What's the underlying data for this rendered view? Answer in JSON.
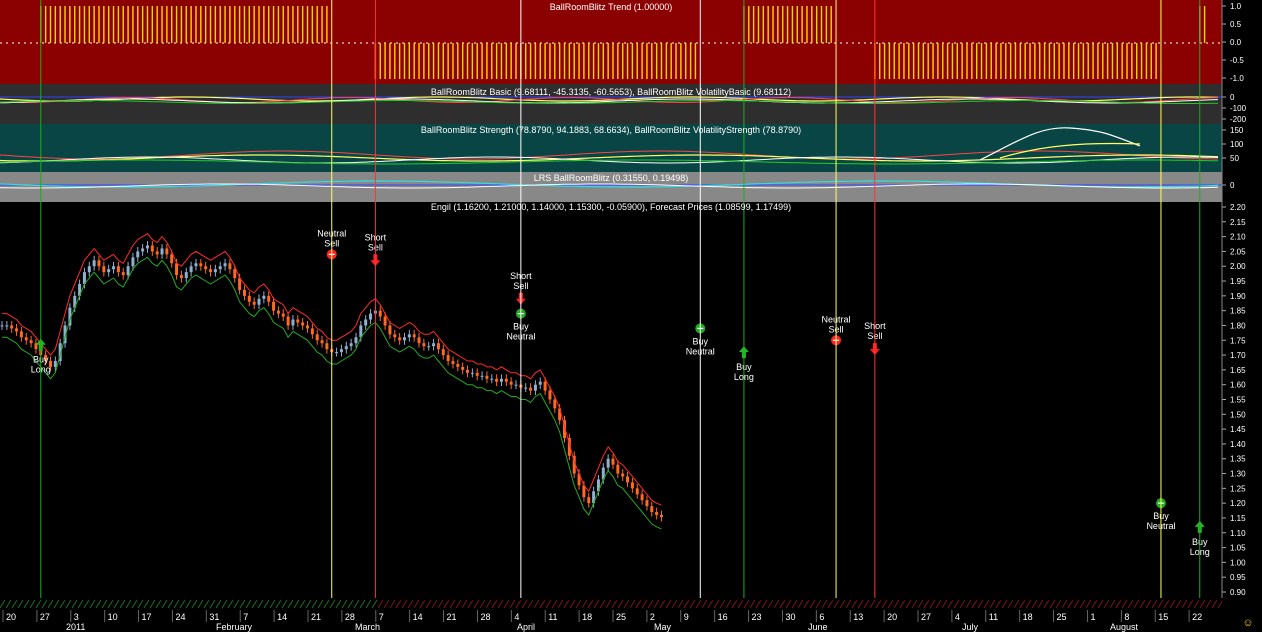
{
  "panels": {
    "trend": {
      "title": "BallRoomBlitz Trend (1.00000)",
      "axis_labels": [
        "1.0",
        "0.5",
        "0.0",
        "-0.5",
        "-1.0"
      ],
      "colors": {
        "bg": "#8b0000",
        "bars": "#ffd700"
      }
    },
    "basic": {
      "title": "BallRoomBlitz Basic (9.68111, -45.3135, -60.5653), BallRoomBlitz VolatilityBasic (9.68112)",
      "axis_labels": [
        "0",
        "-100",
        "-200"
      ],
      "colors": {
        "bg": "#2e2e2e"
      }
    },
    "strength": {
      "title": "BallRoomBlitz Strength (78.8790, 94.1883, 68.6634), BallRoomBlitz VolatilityStrength (78.8790)",
      "axis_labels": [
        "150",
        "100",
        "50"
      ],
      "colors": {
        "bg": "#0a4545"
      }
    },
    "lrs": {
      "title": "LRS BallRoomBlitz (0.31550, 0.19498)",
      "axis_labels": [
        "0"
      ],
      "colors": {
        "bg": "#888888"
      }
    },
    "price": {
      "title": "Engil (1.16200, 1.21000, 1.14000, 1.15300, -0.05900), Forecast Prices (1.08599, 1.17499)",
      "axis_labels": [
        "2.20",
        "2.15",
        "2.10",
        "2.05",
        "2.00",
        "1.95",
        "1.90",
        "1.85",
        "1.80",
        "1.75",
        "1.70",
        "1.65",
        "1.60",
        "1.55",
        "1.50",
        "1.45",
        "1.40",
        "1.35",
        "1.30",
        "1.25",
        "1.20",
        "1.15",
        "1.10",
        "1.05",
        "1.00",
        "0.95",
        "0.90"
      ],
      "colors": {
        "up": "#8fb0d0",
        "down": "#ff6a20"
      }
    }
  },
  "chart_data": {
    "type": "candlestick",
    "ylim": [
      0.9,
      2.2
    ],
    "x": [
      "20",
      "27",
      "3",
      "10",
      "17",
      "24",
      "31",
      "7",
      "14",
      "21",
      "28",
      "7",
      "14",
      "21",
      "28",
      "4",
      "11",
      "18",
      "25",
      "2",
      "9",
      "16",
      "23",
      "30",
      "6",
      "13",
      "20",
      "27",
      "4",
      "11",
      "18",
      "25",
      "1",
      "8",
      "15",
      "22"
    ],
    "months": [
      "2011",
      "February",
      "March",
      "April",
      "May",
      "June",
      "July",
      "August"
    ],
    "close": [
      1.8,
      1.8,
      1.79,
      1.78,
      1.76,
      1.75,
      1.74,
      1.72,
      1.7,
      1.68,
      1.66,
      1.68,
      1.74,
      1.8,
      1.86,
      1.9,
      1.94,
      1.98,
      2.0,
      2.02,
      2.0,
      1.98,
      1.99,
      2.0,
      1.98,
      1.97,
      2.0,
      2.03,
      2.05,
      2.06,
      2.07,
      2.05,
      2.04,
      2.06,
      2.04,
      2.01,
      1.97,
      1.96,
      1.98,
      2.0,
      2.01,
      2.0,
      1.99,
      1.98,
      1.99,
      2.0,
      2.01,
      1.99,
      1.96,
      1.92,
      1.9,
      1.88,
      1.87,
      1.89,
      1.9,
      1.88,
      1.85,
      1.84,
      1.83,
      1.8,
      1.82,
      1.81,
      1.8,
      1.79,
      1.77,
      1.75,
      1.74,
      1.72,
      1.71,
      1.71,
      1.72,
      1.73,
      1.74,
      1.76,
      1.8,
      1.82,
      1.84,
      1.85,
      1.83,
      1.8,
      1.77,
      1.76,
      1.75,
      1.76,
      1.77,
      1.76,
      1.74,
      1.73,
      1.73,
      1.74,
      1.72,
      1.7,
      1.68,
      1.67,
      1.66,
      1.65,
      1.64,
      1.64,
      1.63,
      1.63,
      1.62,
      1.62,
      1.61,
      1.62,
      1.61,
      1.6,
      1.6,
      1.59,
      1.59,
      1.58,
      1.6,
      1.61,
      1.58,
      1.55,
      1.52,
      1.48,
      1.42,
      1.36,
      1.3,
      1.26,
      1.22,
      1.2,
      1.24,
      1.28,
      1.32,
      1.35,
      1.33,
      1.3,
      1.29,
      1.27,
      1.25,
      1.23,
      1.21,
      1.19,
      1.17,
      1.16,
      1.153
    ],
    "signals": [
      {
        "label": [
          "Buy",
          "Long"
        ],
        "kind": "buy-long",
        "day": 8,
        "price": 1.735
      },
      {
        "label": [
          "Neutral",
          "Sell"
        ],
        "kind": "neutral",
        "day": 68,
        "price": 2.04
      },
      {
        "label": [
          "Short",
          "Sell"
        ],
        "kind": "short",
        "day": 77,
        "price": 2.02
      },
      {
        "label": [
          "Buy",
          "Neutral"
        ],
        "kind": "buy-neutral",
        "day": 107,
        "price": 1.84
      },
      {
        "label": [
          "Short",
          "Sell"
        ],
        "kind": "short",
        "day": 107,
        "price": 1.89
      },
      {
        "label": [
          "Buy",
          "Neutral"
        ],
        "kind": "buy-neutral",
        "day": 144,
        "price": 1.79
      },
      {
        "label": [
          "Buy",
          "Long"
        ],
        "kind": "buy-long",
        "day": 153,
        "price": 1.71
      },
      {
        "label": [
          "Neutral",
          "Sell"
        ],
        "kind": "neutral",
        "day": 172,
        "price": 1.75
      },
      {
        "label": [
          "Short",
          "Sell"
        ],
        "kind": "short",
        "day": 180,
        "price": 1.72
      },
      {
        "label": [
          "Buy",
          "Neutral"
        ],
        "kind": "buy-neutral",
        "day": 239,
        "price": 1.2
      },
      {
        "label": [
          "Buy",
          "Long"
        ],
        "kind": "buy-long",
        "day": 247,
        "price": 1.12
      }
    ],
    "vlines": [
      {
        "day": 8,
        "color": "#22aa22"
      },
      {
        "day": 68,
        "color": "#ffff66"
      },
      {
        "day": 77,
        "color": "#ff3333"
      },
      {
        "day": 107,
        "color": "#ffffff"
      },
      {
        "day": 144,
        "color": "#ffffff"
      },
      {
        "day": 153,
        "color": "#22aa22"
      },
      {
        "day": 172,
        "color": "#ffff66"
      },
      {
        "day": 180,
        "color": "#ff3333"
      },
      {
        "day": 239,
        "color": "#ffff66"
      },
      {
        "day": 247,
        "color": "#22aa22"
      }
    ]
  },
  "footer": {
    "smiley": "☺"
  }
}
